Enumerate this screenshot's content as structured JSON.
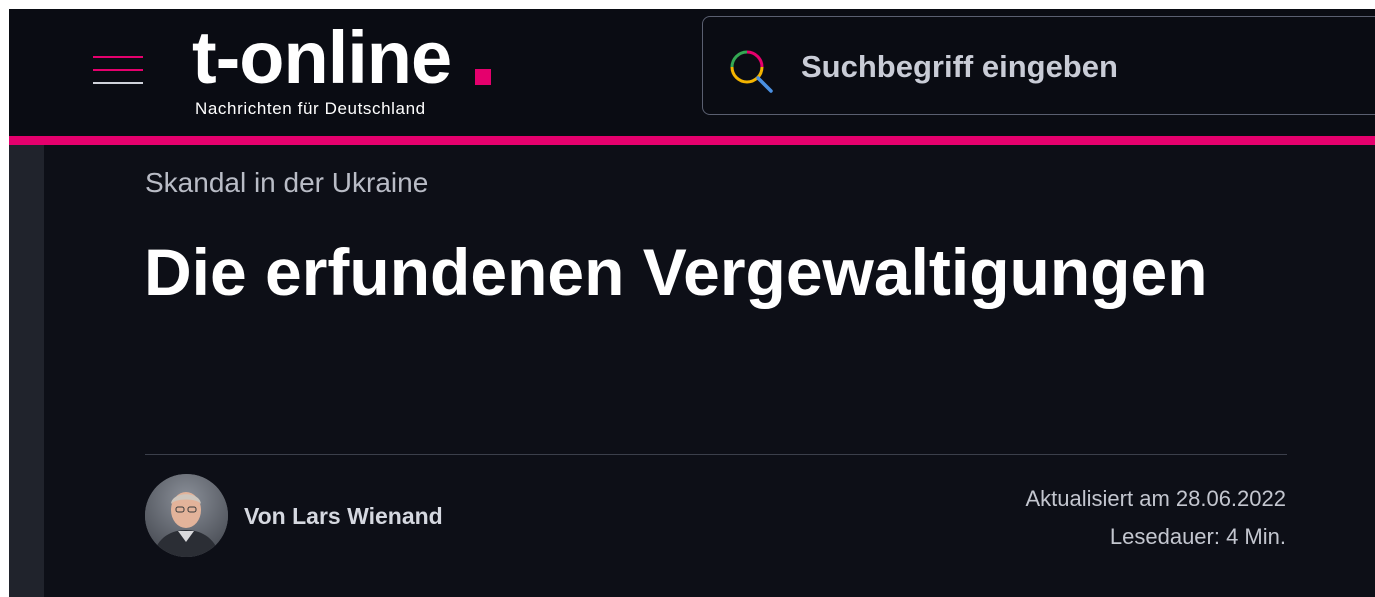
{
  "header": {
    "logo": {
      "wordmark": "t-online",
      "tagline": "Nachrichten für Deutschland",
      "dot_color": "#e5006d"
    },
    "menu_icon": "hamburger-menu-icon",
    "search": {
      "icon": "search-icon",
      "placeholder": "Suchbegriff eingeben"
    },
    "accent_color": "#e5006d"
  },
  "article": {
    "kicker": "Skandal in der Ukraine",
    "headline": "Die erfundenen Vergewaltigungen",
    "author": "Von Lars Wienand",
    "updated": "Aktualisiert am 28.06.2022",
    "reading_time": "Lesedauer: 4 Min."
  }
}
